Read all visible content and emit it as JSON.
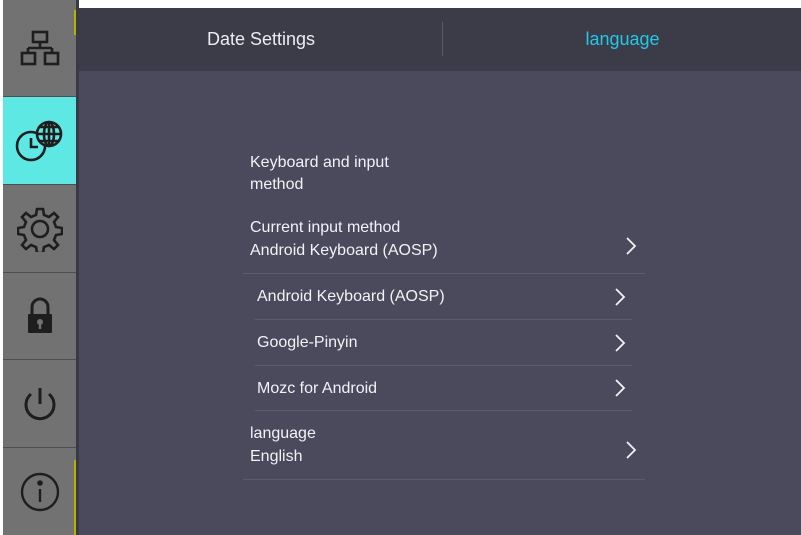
{
  "tabs": {
    "date_settings": "Date Settings",
    "language": "language"
  },
  "sidebar": {
    "items": [
      {
        "icon": "network-icon",
        "active": false
      },
      {
        "icon": "clock-globe-icon",
        "active": true
      },
      {
        "icon": "gear-icon",
        "active": false
      },
      {
        "icon": "lock-icon",
        "active": false
      },
      {
        "icon": "power-icon",
        "active": false
      },
      {
        "icon": "info-icon",
        "active": false
      }
    ]
  },
  "content": {
    "keyboard_section": {
      "line1": "Keyboard and input",
      "line2": "method"
    },
    "current_input": {
      "title": "Current input method",
      "value": "Android Keyboard (AOSP)"
    },
    "keyboards": [
      {
        "label": "Android Keyboard (AOSP)"
      },
      {
        "label": "Google-Pinyin"
      },
      {
        "label": "Mozc for Android"
      }
    ],
    "language_row": {
      "title": "language",
      "value": "English"
    }
  },
  "colors": {
    "background": "#4a4a5c",
    "tabbar": "#3c3c48",
    "active_tab_text": "#22c8e8",
    "sidebar_active": "#5ee8e4",
    "sidebar": "#727272"
  }
}
